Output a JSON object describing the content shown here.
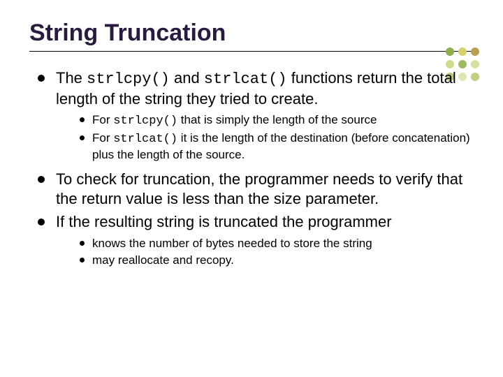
{
  "title": "String Truncation",
  "b1_pre": "The ",
  "b1_c1": "strlcpy()",
  "b1_mid": " and ",
  "b1_c2": "strlcat()",
  "b1_post": " functions return the total length of the string they tried to create.",
  "b1s1_pre": "For ",
  "b1s1_c": "strlcpy()",
  "b1s1_post": " that is simply the length of the source",
  "b1s2_pre": "For ",
  "b1s2_c": "strlcat()",
  "b1s2_post": " it is the length of the destination (before concatenation) plus the length of the source.",
  "b2": "To check for truncation, the programmer needs to verify that the return value is less than the size parameter.",
  "b3": "If the resulting string is truncated the programmer",
  "b3s1": "knows the number of bytes needed to store the string",
  "b3s2": "may reallocate and recopy."
}
